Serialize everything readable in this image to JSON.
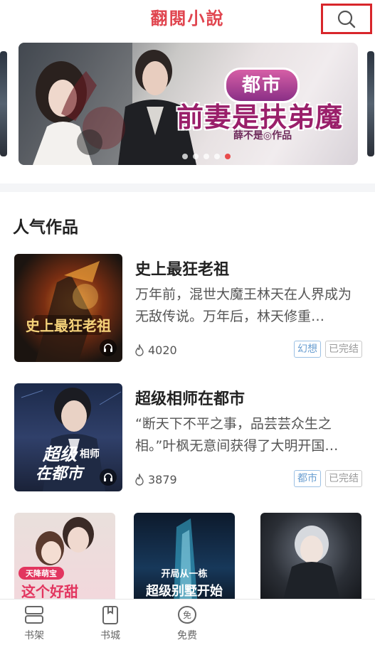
{
  "header": {
    "app_title": "翻閱小說",
    "search_icon": "search-icon"
  },
  "banner": {
    "tag": "都市",
    "title": "前妻是扶弟魔",
    "author": "薛不是◎作品",
    "slide_count": 5,
    "active_slide": 5
  },
  "section": {
    "title": "人气作品"
  },
  "books": [
    {
      "title": "史上最狂老祖",
      "description": "万年前，混世大魔王林天在人界成为无敌传说。万年后，林天修重…",
      "views": "4020",
      "genre": "幻想",
      "status": "已完结",
      "cover_text": "史上最狂老祖"
    },
    {
      "title": "超级相师在都市",
      "description": "“断天下不平之事，品芸芸众生之相。”叶枫无意间获得了大明开国…",
      "views": "3879",
      "genre": "都市",
      "status": "已完结",
      "cover_text_a": "超级",
      "cover_text_b": "相师",
      "cover_text_c": "在都市"
    }
  ],
  "grid_books": [
    {
      "cover_text": "这个好甜",
      "cover_badge": "天降萌宝"
    },
    {
      "cover_text": "超级别墅开始",
      "cover_badge": "开局从一栋"
    },
    {
      "cover_text": ""
    }
  ],
  "tabbar": {
    "items": [
      {
        "label": "书架",
        "icon": "bookshelf-icon"
      },
      {
        "label": "书城",
        "icon": "bookstore-icon"
      },
      {
        "label": "免费",
        "icon": "free-icon",
        "icon_text": "免"
      }
    ]
  },
  "colors": {
    "brand": "#e0454f",
    "highlight": "#d8262b",
    "genre_tag": "#6b9fd1"
  }
}
